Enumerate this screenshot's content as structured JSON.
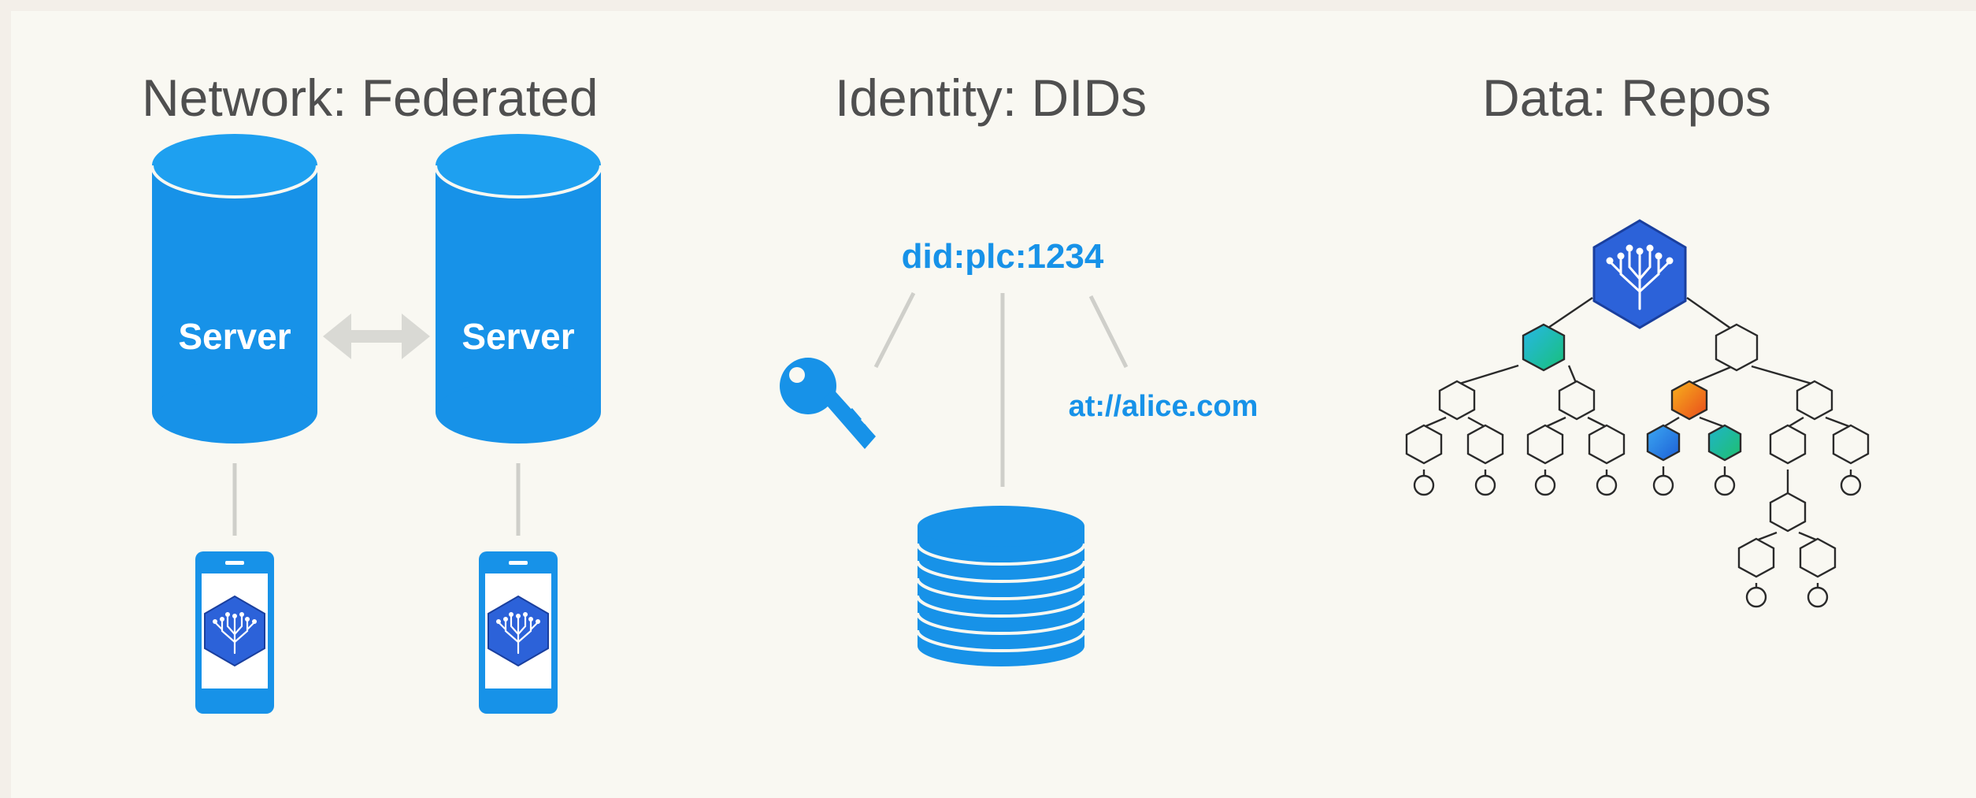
{
  "sections": {
    "network": {
      "title": "Network: Federated"
    },
    "identity": {
      "title": "Identity: DIDs"
    },
    "data": {
      "title": "Data: Repos"
    }
  },
  "network": {
    "servers": [
      {
        "label": "Server"
      },
      {
        "label": "Server"
      }
    ]
  },
  "identity": {
    "did": "did:plc:1234",
    "handle": "at://alice.com"
  },
  "colors": {
    "background": "#f9f8f2",
    "frame": "#f3efe9",
    "blue": "#1792e8",
    "text_gray": "#4f4f4f",
    "line_gray": "#c8c8c2",
    "node_dark": "#2a2a2a",
    "logo_blue": "#2c62d9",
    "teal": "#19b99a",
    "orange": "#f08a1c"
  },
  "icons": {
    "server": "database-cylinder-icon",
    "phone": "smartphone-icon",
    "app_logo": "hexagon-tree-logo-icon",
    "key": "key-icon",
    "storage": "database-stack-icon",
    "repo_tree": "merkle-tree-icon"
  }
}
